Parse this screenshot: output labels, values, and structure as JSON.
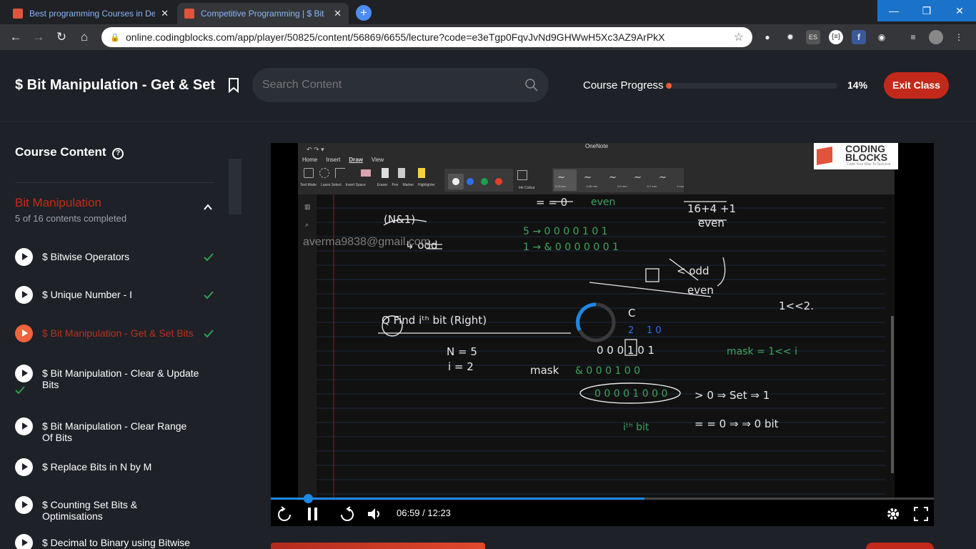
{
  "browser": {
    "tabs": [
      {
        "title": "Best programming Courses in De",
        "active": false
      },
      {
        "title": "Competitive Programming | $ Bit",
        "active": true
      }
    ],
    "url": "online.codingblocks.com/app/player/50825/content/56869/6655/lecture?code=e3eTgp0FqvJvNd9GHWwH5Xc3AZ9ArPkX",
    "extensions": [
      "ninja-icon",
      "gear-icon",
      "es-icon",
      "json-icon",
      "facebook-icon",
      "spy-icon",
      "playlist-icon",
      "avatar"
    ]
  },
  "header": {
    "lecture_title": "$ Bit Manipulation - Get & Set",
    "search_placeholder": "Search Content",
    "progress_label": "Course Progress",
    "progress_percent": 14,
    "progress_text": "14%",
    "exit_label": "Exit Class"
  },
  "sidebar": {
    "title": "Course Content",
    "section": {
      "title": "Bit Manipulation",
      "subtitle": "5 of 16 contents completed"
    },
    "items": [
      {
        "label": "$ Bitwise Operators",
        "completed": true,
        "current": false
      },
      {
        "label": "$ Unique Number - I",
        "completed": true,
        "current": false
      },
      {
        "label": "$ Bit Manipulation - Get & Set Bits",
        "completed": true,
        "current": true
      },
      {
        "label": "$ Bit Manipulation - Clear & Update Bits",
        "completed": true,
        "current": false
      },
      {
        "label": "$ Bit Manipulation - Clear Range Of Bits",
        "completed": false,
        "current": false
      },
      {
        "label": "$ Replace Bits in N by M",
        "completed": false,
        "current": false
      },
      {
        "label": "$ Counting Set Bits & Optimisations",
        "completed": false,
        "current": false
      },
      {
        "label": "$ Decimal to Binary using Bitwise",
        "completed": false,
        "current": false
      }
    ]
  },
  "video": {
    "watermark": "averma9838@gmail.com",
    "app_title": "OneNote",
    "ribbon_tabs": [
      "Home",
      "Insert",
      "Draw",
      "View"
    ],
    "ribbon_tools": [
      "Text Mode",
      "Lasso Select",
      "Insert Space",
      "Eraser",
      "Pen",
      "Marker",
      "Highlighter",
      "Ink Colour"
    ],
    "pen_sizes": [
      "0.25 mm",
      "0.35 mm",
      "0.5 mm",
      "0.7 mm",
      "1 mm"
    ],
    "logo_line1": "CODING",
    "logo_line2": "BLOCKS",
    "logo_tagline": "Code Your Way To Success",
    "time_current": "06:59",
    "time_total": "12:23",
    "time_text": "06:59 / 12:23",
    "played_fraction": 0.564,
    "handle_fraction": 0.056
  },
  "colors": {
    "accent": "#c3291b",
    "check": "#2e9e4f",
    "seek": "#1e88e5"
  }
}
